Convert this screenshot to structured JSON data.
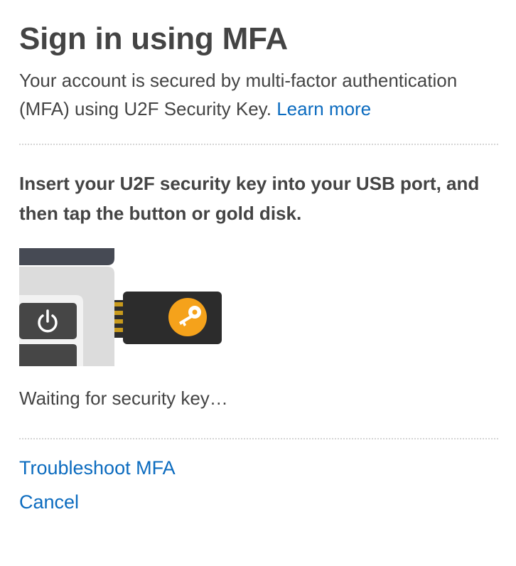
{
  "header": {
    "title": "Sign in using MFA"
  },
  "intro": {
    "text": "Your account is secured by multi-factor authentication (MFA) using U2F Security Key.",
    "learn_more_label": "Learn more"
  },
  "instruction": {
    "text": "Insert your U2F security key into your USB port, and then tap the button or gold disk."
  },
  "illustration": {
    "icons": [
      "laptop-side-illustration",
      "power-icon",
      "usb-security-key-icon",
      "key-icon"
    ],
    "colors": {
      "laptop_body": "#dcdcdc",
      "laptop_lid": "#464a54",
      "power_button": "#464646",
      "key_body": "#2c2c2c",
      "usb_contacts": "#c89a1c",
      "gold_disk": "#f5a21b"
    }
  },
  "status": {
    "text": "Waiting for security key…"
  },
  "links": {
    "troubleshoot_label": "Troubleshoot MFA",
    "cancel_label": "Cancel"
  },
  "colors": {
    "text": "#444444",
    "link": "#0b6bbf",
    "divider": "#d5d5d5"
  }
}
